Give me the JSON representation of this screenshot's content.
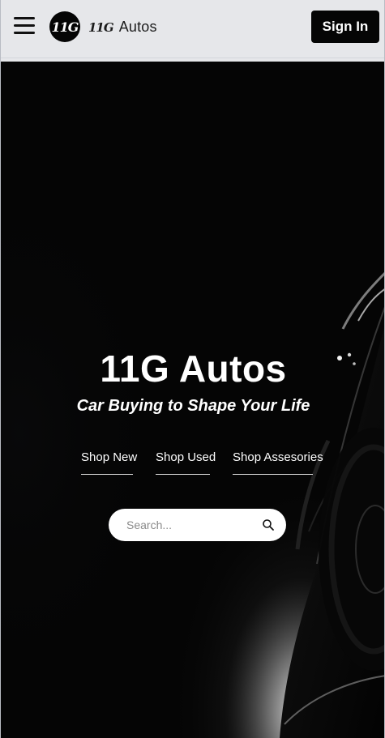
{
  "header": {
    "logo_mark": "11G",
    "brand_mark": "11G",
    "brand_name": "Autos",
    "sign_in_label": "Sign In",
    "menu_icon": "hamburger-menu-icon"
  },
  "hero": {
    "title": "11G Autos",
    "tagline": "Car Buying to Shape Your Life",
    "shop_links": [
      {
        "label": "Shop New"
      },
      {
        "label": "Shop Used"
      },
      {
        "label": "Shop Assesories"
      }
    ],
    "search": {
      "placeholder": "Search...",
      "value": "",
      "icon": "search-icon"
    }
  },
  "colors": {
    "header_background": "#e6e7ea",
    "button_background": "#050505",
    "hero_background": "#050505",
    "text_light": "#ffffff"
  }
}
